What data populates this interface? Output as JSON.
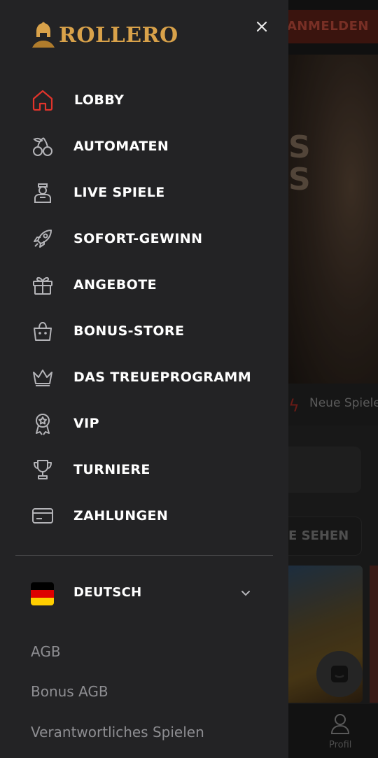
{
  "background": {
    "login_label": "ANMELDEN",
    "hero_text": "S\nS",
    "new_games_label": "Neue Spiele",
    "see_all_label": "E SEHEN",
    "profile_label": "Profil"
  },
  "drawer": {
    "brand": "ROLLERO",
    "close_icon": "close-icon",
    "nav_items": [
      {
        "label": "LOBBY",
        "icon": "home-icon",
        "active": true
      },
      {
        "label": "AUTOMATEN",
        "icon": "cherries-icon"
      },
      {
        "label": "LIVE SPIELE",
        "icon": "dealer-icon"
      },
      {
        "label": "SOFORT-GEWINN",
        "icon": "rocket-icon"
      },
      {
        "label": "ANGEBOTE",
        "icon": "gift-icon"
      },
      {
        "label": "BONUS-STORE",
        "icon": "shopping-bag-icon"
      },
      {
        "label": "DAS TREUEPROGRAMM",
        "icon": "crown-icon"
      },
      {
        "label": "VIP",
        "icon": "award-badge-icon"
      },
      {
        "label": "TURNIERE",
        "icon": "trophy-icon"
      },
      {
        "label": "ZAHLUNGEN",
        "icon": "credit-card-icon"
      }
    ],
    "language": {
      "label": "DEUTSCH",
      "flag": "germany-flag"
    },
    "footer_links": [
      "AGB",
      "Bonus AGB",
      "Verantwortliches Spielen"
    ]
  },
  "colors": {
    "drawer_bg": "#232325",
    "accent_red": "#e0342b",
    "brand_gold": "#d9a24a",
    "icon_gray": "#b4b4b8"
  }
}
